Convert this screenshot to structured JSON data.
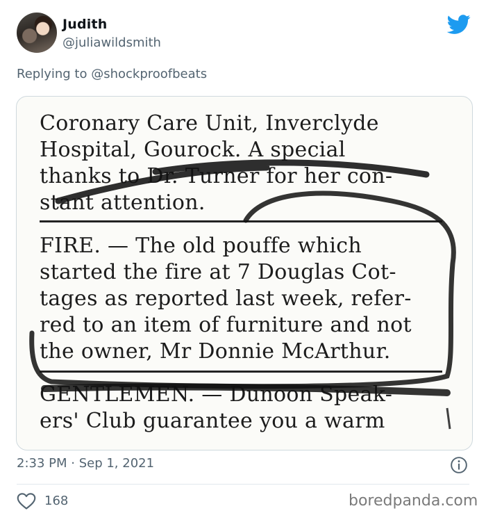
{
  "tweet": {
    "author_name": "Judith",
    "author_handle": "@juliawildsmith",
    "replying_prefix": "Replying to",
    "replying_to": "@shockproofbeats",
    "timestamp": "2:33 PM · Sep 1, 2021",
    "likes": "168"
  },
  "clipping": {
    "lines": [
      "Coronary Care Unit, Inverclyde",
      "Hospital, Gourock. A special",
      "thanks to Dr. Turner for her con-",
      "stant attention.",
      "FIRE. — The old pouffe which",
      "started the fire at 7 Douglas Cot-",
      "tages as reported last week, refer-",
      "red to an item of furniture and not",
      "the owner, Mr Donnie McArthur.",
      "GENTLEMEN. — Dunoon Speak-",
      "ers' Club guarantee you a warm"
    ]
  },
  "watermark": "boredpanda.com",
  "colors": {
    "brand": "#1d9bf0",
    "muted": "#536471",
    "border": "#cfd9de"
  },
  "icons": [
    "twitter-bird-icon",
    "info-icon",
    "heart-icon"
  ]
}
